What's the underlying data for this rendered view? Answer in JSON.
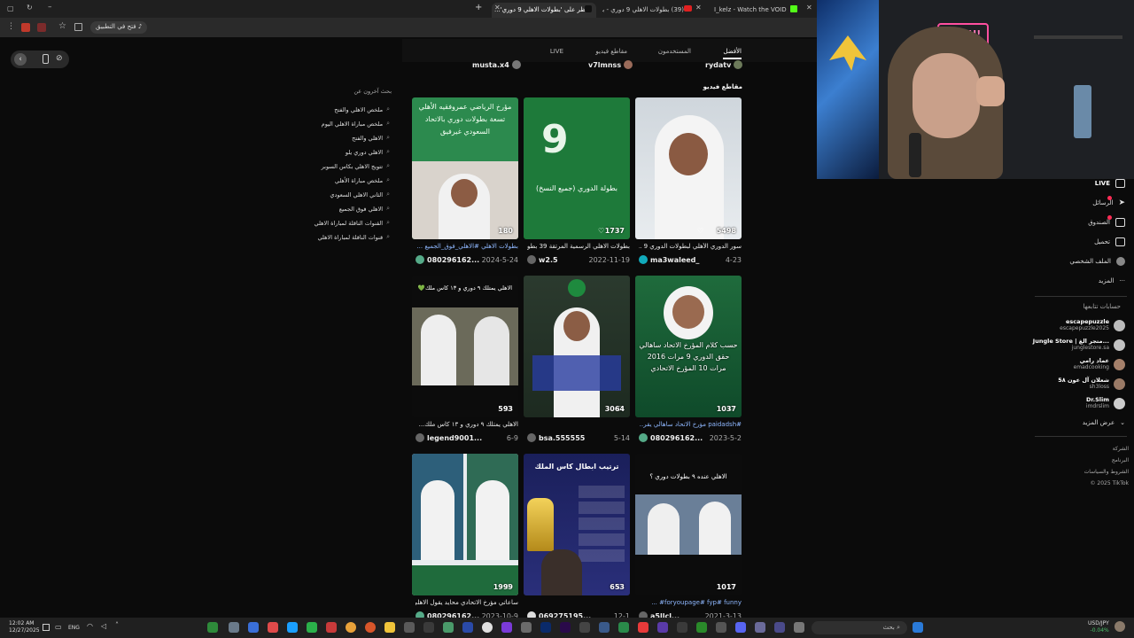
{
  "browser": {
    "tabs": [
      {
        "label": "I_kelz - Watch the VOID on Kick"
      },
      {
        "label": "(39) بطولات الاهلي 9 دوري - بعد..."
      },
      {
        "label": "انظر على 'بطولات الاهلي 9 دوري'..."
      }
    ],
    "open_in_app": "فتح في التطبيق"
  },
  "tiktok_tabs": {
    "top": "الأفضل",
    "users": "المستخدمون",
    "videos": "مقاطع فيديو",
    "live": "LIVE"
  },
  "top_users": [
    "rydatv",
    "v7lmnss",
    "musta.x4"
  ],
  "section_title": "مقاطع فيديو",
  "videos": [
    {
      "likes": "5498",
      "caption": "سور الدوري الأهلي لبطولات الدوري 9 ...",
      "user": "ma3waleed_",
      "date": "4-23",
      "overlay": ""
    },
    {
      "likes": "1737",
      "caption": "بطولات الاهلي الرسمية المرتقة 39 بطول...",
      "user": "w2.5",
      "date": "2022-11-19",
      "overlay": "بطولة الدوري (جميع النسخ)"
    },
    {
      "likes": "180",
      "caption": "بطولات الاهلي #الاهلي_فوق_الجميع ...",
      "user": "080296162...",
      "date": "2024-5-24",
      "overlay": "مؤرخ الرياضي عمروفقيه الأهلي تسعة بطولات دوري بالاتحاد السعودي غيرفيق"
    },
    {
      "likes": "1037",
      "caption": "#paidadsh مؤرخ الاتحاد ساهالي يقر...",
      "user": "080296162...",
      "date": "2023-5-2",
      "overlay": "حسب كلام المؤرخ الاتحاد ساهالي حقق الدوري 9 مرات 2016 مرات 10 المؤرخ الاتحادي"
    },
    {
      "likes": "3064",
      "caption": "",
      "user": "bsa.555555",
      "date": "5-14",
      "overlay": ""
    },
    {
      "likes": "593",
      "caption": "الاهلي يمتلك ٩ دوري و ١٣ كاس ملك...",
      "user": "legend9001...",
      "date": "6-9",
      "overlay": "الاهلي يمتلك ٩ دوري و ١٣ كاس ملك💚"
    },
    {
      "likes": "1017",
      "caption": "foryoupage# fyp# funny# ...",
      "user": "a5llcl...",
      "date": "2021-3-13",
      "overlay": "الاهلي عنده ٩ بطولات دوري ؟"
    },
    {
      "likes": "653",
      "caption": "",
      "user": "069275195...",
      "date": "12-1",
      "overlay": "ترتيب ابطال كاس الملك"
    },
    {
      "likes": "1999",
      "caption": "ساعاتي مؤرخ الاتحادي محايد يقول الاهلي ...",
      "user": "080296162...",
      "date": "2023-10-9",
      "overlay": ""
    }
  ],
  "related_title": "بحث آخرون عن",
  "related_searches": [
    "ملخص الاهلي والفتح",
    "ملخص مباراة الاهلي اليوم",
    "الاهلي والفتح",
    "الاهلي دوري يلو",
    "تتويج الاهلي بكاس السوبر",
    "ملخص مباراة الأهلي",
    "الثاني الاهلي السعودي",
    "الاهلي فوق الجميع",
    "القنوات الناقلة لمباراة الاهلي",
    "قنوات الناقلة لمباراة الاهلي"
  ],
  "sidebar": {
    "nav": [
      {
        "label": "LIVE",
        "icon": "live-icon"
      },
      {
        "label": "الرسائل",
        "icon": "send-icon"
      },
      {
        "label": "الصندوق",
        "icon": "inbox-icon"
      },
      {
        "label": "تحميل",
        "icon": "upload-icon"
      },
      {
        "label": "الملف الشخصي",
        "icon": "profile-icon"
      },
      {
        "label": "المزيد",
        "icon": "more-icon"
      }
    ],
    "following_title": "حسابات تتابعها",
    "following": [
      {
        "name": "escapepuzzle",
        "handle": "escapepuzzle2025"
      },
      {
        "name": "Jungle Store | متجر الغ...",
        "handle": "junglestore.sa"
      },
      {
        "name": "عماد رامي",
        "handle": "emadcooking"
      },
      {
        "name": "شعلان آل عون 5٨",
        "handle": "sh3loss"
      },
      {
        "name": "Dr.Slim",
        "handle": "imdrslim"
      }
    ],
    "see_more": "عرض المزيد",
    "footer": [
      "الشركة",
      "البرنامج",
      "الشروط والسياسات",
      "© 2025 TikTok"
    ]
  },
  "taskbar": {
    "time": "12:02 AM",
    "date": "12/27/2025",
    "lang": "ENG",
    "search": "بحث",
    "ticker": "USD/JPY",
    "ticker_change": "-0.04%"
  },
  "webcam": {
    "neon": "SHHH!"
  }
}
